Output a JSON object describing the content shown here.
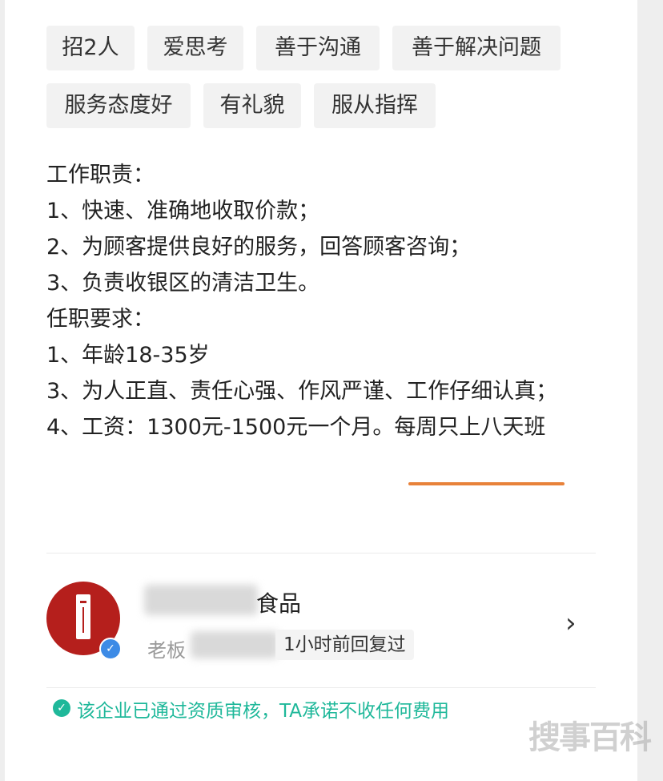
{
  "tags": [
    "招2人",
    "爱思考",
    "善于沟通",
    "善于解决问题",
    "服务态度好",
    "有礼貌",
    "服从指挥"
  ],
  "description": {
    "duties_heading": "工作职责：",
    "duties": [
      "1、快速、准确地收取价款；",
      "2、为顾客提供良好的服务，回答顾客咨询；",
      "3、负责收银区的清洁卫生。"
    ],
    "requirements_heading": "任职要求：",
    "requirements": [
      "1、年龄18-35岁",
      "3、为人正直、责任心强、作风严谨、工作仔细认真；"
    ],
    "salary_line": "4、工资：1300元-1500元一个月。",
    "salary_highlight": "每周只上八天班",
    "highlight_color": "#e8823a"
  },
  "company": {
    "name_suffix": "食品",
    "role": "老板",
    "reply_status": "1小时前回复过"
  },
  "verification": {
    "text": "该企业已通过资质审核，TA承诺不收任何费用",
    "color": "#1fb89a"
  },
  "watermark": "搜事百科",
  "icons": {
    "chevron": "chevron-right-icon",
    "verified": "verified-badge-icon",
    "shield": "shield-check-icon"
  }
}
